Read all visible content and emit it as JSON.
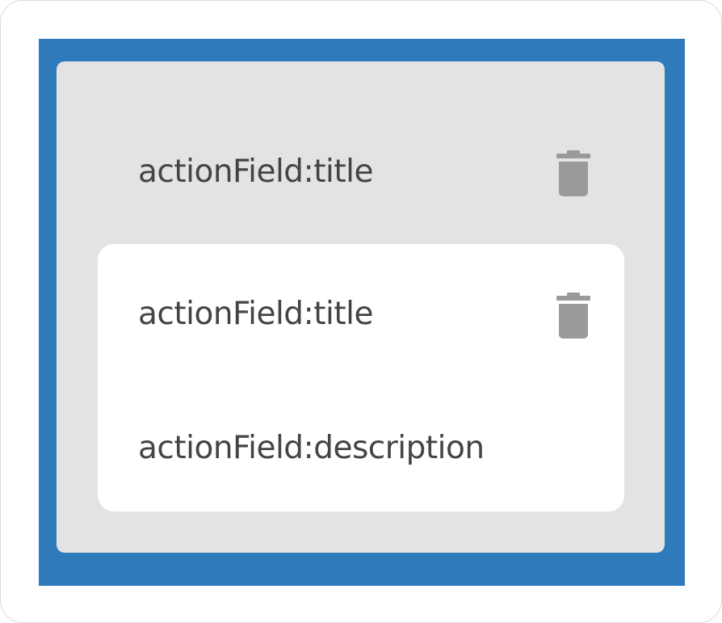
{
  "outer_item": {
    "title": "actionField:title",
    "delete_icon": "trash-icon"
  },
  "inner_item": {
    "title": "actionField:title",
    "description": "actionField:description",
    "delete_icon": "trash-icon"
  },
  "colors": {
    "panel_blue": "#2f7abb",
    "card_grey": "#e3e3e3",
    "card_white": "#ffffff",
    "text": "#444444",
    "icon": "#9a9a9a"
  }
}
